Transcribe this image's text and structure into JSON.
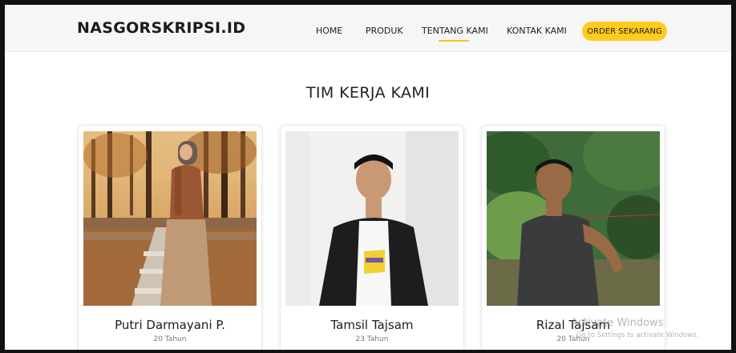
{
  "navbar": {
    "brand": "NASGORSKRIPSI.ID",
    "links": [
      "HOME",
      "PRODUK",
      "TENTANG KAMI",
      "KONTAK KAMI"
    ],
    "active_link": "TENTANG KAMI",
    "cta_label": "ORDER SEKARANG",
    "cta_color": "#ffcb1f",
    "accent_color": "#f5c518"
  },
  "section": {
    "title": "TIM KERJA KAMI"
  },
  "team": [
    {
      "name": "Putri Darmayani P.",
      "age": "20 Tahun"
    },
    {
      "name": "Tamsil Tajsam",
      "age": "23 Tahun"
    },
    {
      "name": "Rizal Tajsam",
      "age": "20 Tahun"
    }
  ],
  "watermark": {
    "line1": "Activate Windows",
    "line2": "Go to Settings to activate Windows."
  }
}
